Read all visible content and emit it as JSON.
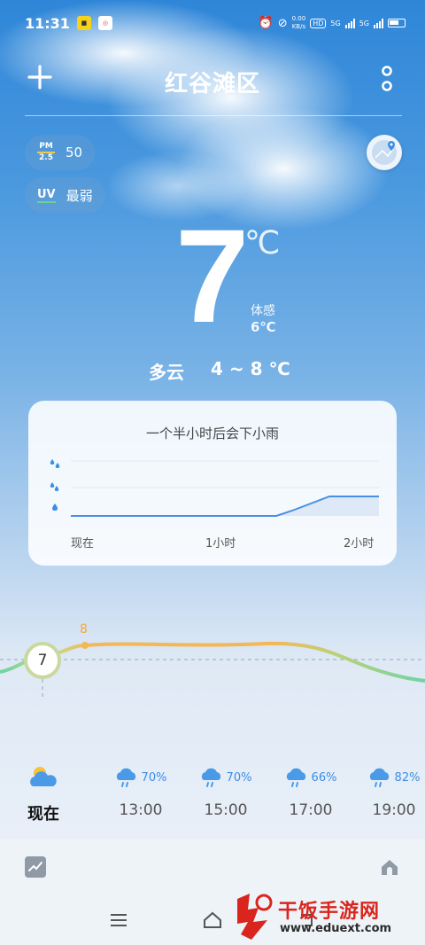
{
  "status_bar": {
    "time": "11:31",
    "net_speed_top": "0.00",
    "net_speed_bottom": "KB/s",
    "hd": "HD",
    "net1": "5G",
    "net2": "5G"
  },
  "header": {
    "city": "红谷滩区"
  },
  "air": {
    "pm_label_top": "PM",
    "pm_label_bottom": "2.5",
    "pm_value": "50",
    "uv_label": "UV",
    "uv_value": "最弱"
  },
  "current": {
    "temp": "7",
    "unit": "℃",
    "feels_label": "体感",
    "feels_value": "6℃",
    "condition": "多云",
    "range": "4 ~ 8 ℃"
  },
  "rain": {
    "title": "一个半小时后会下小雨",
    "x_labels": [
      "现在",
      "1小时",
      "2小时"
    ]
  },
  "hourly": {
    "now_temp": "7",
    "peak_label": "8",
    "items": [
      {
        "time": "现在",
        "pct": "",
        "icon": "partly-cloudy-icon"
      },
      {
        "time": "13:00",
        "pct": "70%",
        "icon": "light-rain-icon"
      },
      {
        "time": "15:00",
        "pct": "70%",
        "icon": "light-rain-icon"
      },
      {
        "time": "17:00",
        "pct": "66%",
        "icon": "light-rain-icon"
      },
      {
        "time": "19:00",
        "pct": "82%",
        "icon": "light-rain-icon"
      }
    ]
  },
  "watermark": {
    "brand": "干饭手游网",
    "url": "www.eduext.com"
  },
  "colors": {
    "accent_blue": "#3a8ee6",
    "curve_orange": "#f2b856",
    "curve_green": "#6fd3a3"
  }
}
